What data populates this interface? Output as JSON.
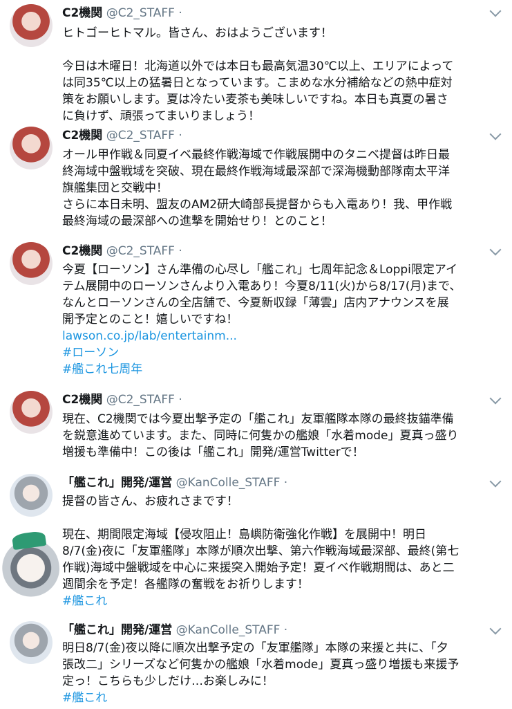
{
  "tweets": [
    {
      "name": "C2機関",
      "handle": "@C2_STAFF ·",
      "lines": [
        "ヒトゴーヒトマル。皆さん、おはようございます！",
        "",
        "今日は木曜日！北海道以外では本日も最高気温30℃以上、エリアによって",
        "は同35℃以上の猛暑日となっています。こまめな水分補給などの熱中症対",
        "策をお願いします。夏は冷たい麦茶も美味しいですね。本日も真夏の暑さ",
        "に負けず、頑張ってまいりましょう！"
      ]
    },
    {
      "name": "C2機関",
      "handle": "@C2_STAFF ·",
      "lines": [
        "オール甲作戦＆同夏イベ最終作戦海域で作戦展開中のタニベ提督は昨日最",
        "終海域中盤戦域を突破、現在最終作戦海域最深部で深海機動部隊南太平洋",
        "旗艦集団と交戦中！",
        "さらに本日未明、盟友のAM2研大崎部長提督からも入電あり！我、甲作戦",
        "最終海域の最深部への進撃を開始せり！とのこと！"
      ]
    },
    {
      "name": "C2機関",
      "handle": "@C2_STAFF ·",
      "lines": [
        "今夏【ローソン】さん準備の心尽し「艦これ」七周年記念＆Loppi限定アイ",
        "テム展開中のローソンさんより入電あり！今夏8/11(火)から8/17(月)まで、",
        "なんとローソンさんの全店舗で、今夏新収録「薄雲」店内アナウンスを展",
        "開予定とのこと！嬉しいですね！"
      ],
      "link": "lawson.co.jp/lab/entertainm...",
      "hashtags": [
        "#ローソン",
        "#艦これ七周年"
      ]
    },
    {
      "name": "C2機関",
      "handle": "@C2_STAFF ·",
      "lines": [
        "現在、C2機関では今夏出撃予定の「艦これ」友軍艦隊本隊の最終抜錨準備",
        "を鋭意進めています。また、同時に何隻かの艦娘「水着mode」夏真っ盛り",
        "増援も準備中！この後は「艦これ」開発/運営Twitterで！"
      ]
    },
    {
      "name": "「艦これ」開発/運営",
      "handle": "@KanColle_STAFF ·",
      "lines": [
        "提督の皆さん、お疲れさまです！",
        "",
        "現在、期間限定海域【侵攻阻止！島嶼防衛強化作戦】を展開中！明日",
        "8/7(金)夜に「友軍艦隊」本隊が順次出撃、第六作戦海域最深部、最終(第七",
        "作戦)海域中盤戦域を中心に来援突入開始予定！夏イベ作戦期間は、あと二",
        "週間余を予定！各艦隊の奮戦をお祈りします！"
      ],
      "hashtags": [
        "#艦これ"
      ]
    },
    {
      "name": "「艦これ」開発/運営",
      "handle": "@KanColle_STAFF ·",
      "lines": [
        "明日8/7(金)夜以降に順次出撃予定の「友軍艦隊」本隊の来援と共に、「夕",
        "張改二」シリーズなど何隻かの艦娘「水着mode」夏真っ盛り増援も来援予",
        "定っ！こちらも少しだけ…お楽しみに！"
      ],
      "hashtags": [
        "#艦これ"
      ]
    }
  ],
  "colors": {
    "link": "#1b95e0",
    "handle": "#657786",
    "underline": "#f58a1f"
  }
}
